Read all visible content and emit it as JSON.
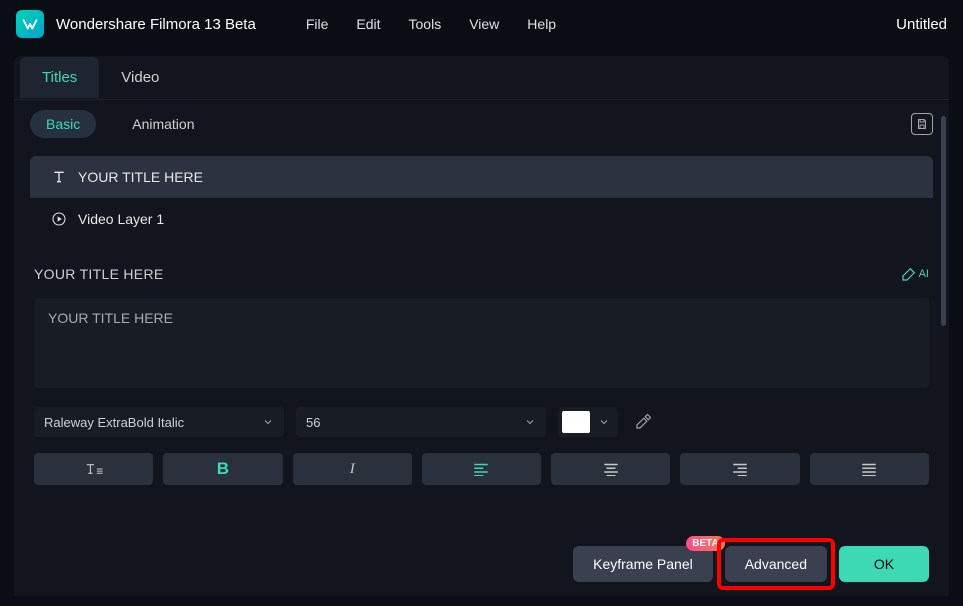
{
  "app": {
    "title": "Wondershare Filmora 13 Beta",
    "document": "Untitled"
  },
  "menu": {
    "items": [
      "File",
      "Edit",
      "Tools",
      "View",
      "Help"
    ]
  },
  "tabs": {
    "primary": [
      {
        "label": "Titles",
        "active": true
      },
      {
        "label": "Video",
        "active": false
      }
    ],
    "secondary": [
      {
        "label": "Basic",
        "active": true
      },
      {
        "label": "Animation",
        "active": false
      }
    ]
  },
  "layers": [
    {
      "label": "YOUR TITLE HERE",
      "icon": "text",
      "selected": true
    },
    {
      "label": "Video Layer 1",
      "icon": "play",
      "selected": false
    }
  ],
  "section": {
    "title": "YOUR TITLE HERE",
    "ai_label": "AI"
  },
  "title_text": {
    "value": "YOUR TITLE HERE"
  },
  "font": {
    "family": "Raleway ExtraBold Italic",
    "size": "56",
    "color": "#ffffff"
  },
  "format_buttons": [
    "text-case",
    "bold",
    "italic",
    "align-left",
    "align-center",
    "align-right",
    "align-justify"
  ],
  "bottom": {
    "keyframe": "Keyframe Panel",
    "advanced": "Advanced",
    "ok": "OK",
    "beta_badge": "BETA"
  }
}
